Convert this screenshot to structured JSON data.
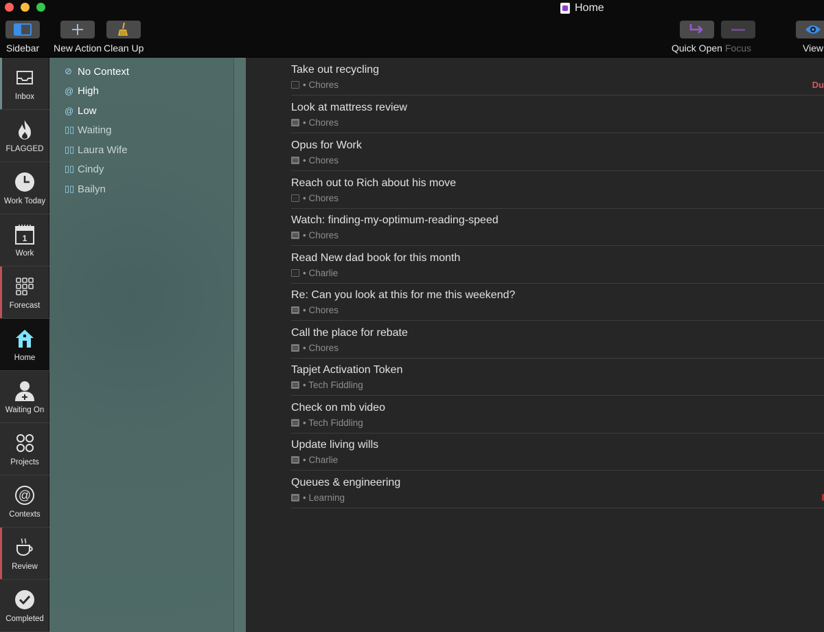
{
  "window": {
    "title": "Home"
  },
  "toolbar": {
    "sidebar_label": "Sidebar",
    "new_action_label": "New Action",
    "clean_up_label": "Clean Up",
    "quick_open_label": "Quick Open",
    "focus_label": "Focus",
    "view_label": "View"
  },
  "rail": {
    "items": [
      {
        "label": "Inbox",
        "icon": "inbox-icon"
      },
      {
        "label": "FLAGGED",
        "icon": "flame-icon"
      },
      {
        "label": "Work Today",
        "icon": "clock-icon"
      },
      {
        "label": "Work",
        "icon": "calendar-icon"
      },
      {
        "label": "Forecast",
        "icon": "grid-icon"
      },
      {
        "label": "Home",
        "icon": "house-icon"
      },
      {
        "label": "Waiting On",
        "icon": "person-icon"
      },
      {
        "label": "Projects",
        "icon": "projects-icon"
      },
      {
        "label": "Contexts",
        "icon": "at-icon"
      },
      {
        "label": "Review",
        "icon": "coffee-cup-icon"
      },
      {
        "label": "Completed",
        "icon": "checkmark-icon"
      }
    ]
  },
  "sidebar": {
    "items": [
      {
        "symbol": "⊘",
        "label": "No Context"
      },
      {
        "symbol": "@",
        "label": "High"
      },
      {
        "symbol": "@",
        "label": "Low"
      },
      {
        "symbol": "▯▯",
        "label": "Waiting"
      },
      {
        "symbol": "▯▯",
        "label": "Laura Wife"
      },
      {
        "symbol": "▯▯",
        "label": "Cindy"
      },
      {
        "symbol": "▯▯",
        "label": "Bailyn"
      }
    ]
  },
  "actions": [
    {
      "title": "Take out recycling",
      "project": "• Chores",
      "due": "Du"
    },
    {
      "title": "Look at mattress review",
      "project": "• Chores"
    },
    {
      "title": "Opus for Work",
      "project": "• Chores"
    },
    {
      "title": "Reach out to Rich about his move",
      "project": "• Chores"
    },
    {
      "title": "Watch: finding-my-optimum-reading-speed",
      "project": "• Chores"
    },
    {
      "title": "Read New dad book for this month",
      "project": "• Charlie"
    },
    {
      "title": "Re: Can you look at this for me this weekend?",
      "project": "• Chores"
    },
    {
      "title": "Call the place for rebate",
      "project": "• Chores"
    },
    {
      "title": "Tapjet Activation Token",
      "project": "• Tech Fiddling"
    },
    {
      "title": "Check on mb video",
      "project": "• Tech Fiddling"
    },
    {
      "title": "Update living wills",
      "project": "• Charlie"
    },
    {
      "title": "Queues & engineering",
      "project": "• Learning"
    }
  ],
  "colors": {
    "accent_red": "#d8565d",
    "quick_open_purple": "#9b59d0",
    "view_blue": "#3a8ee6",
    "home_cyan": "#7fe3ff"
  }
}
